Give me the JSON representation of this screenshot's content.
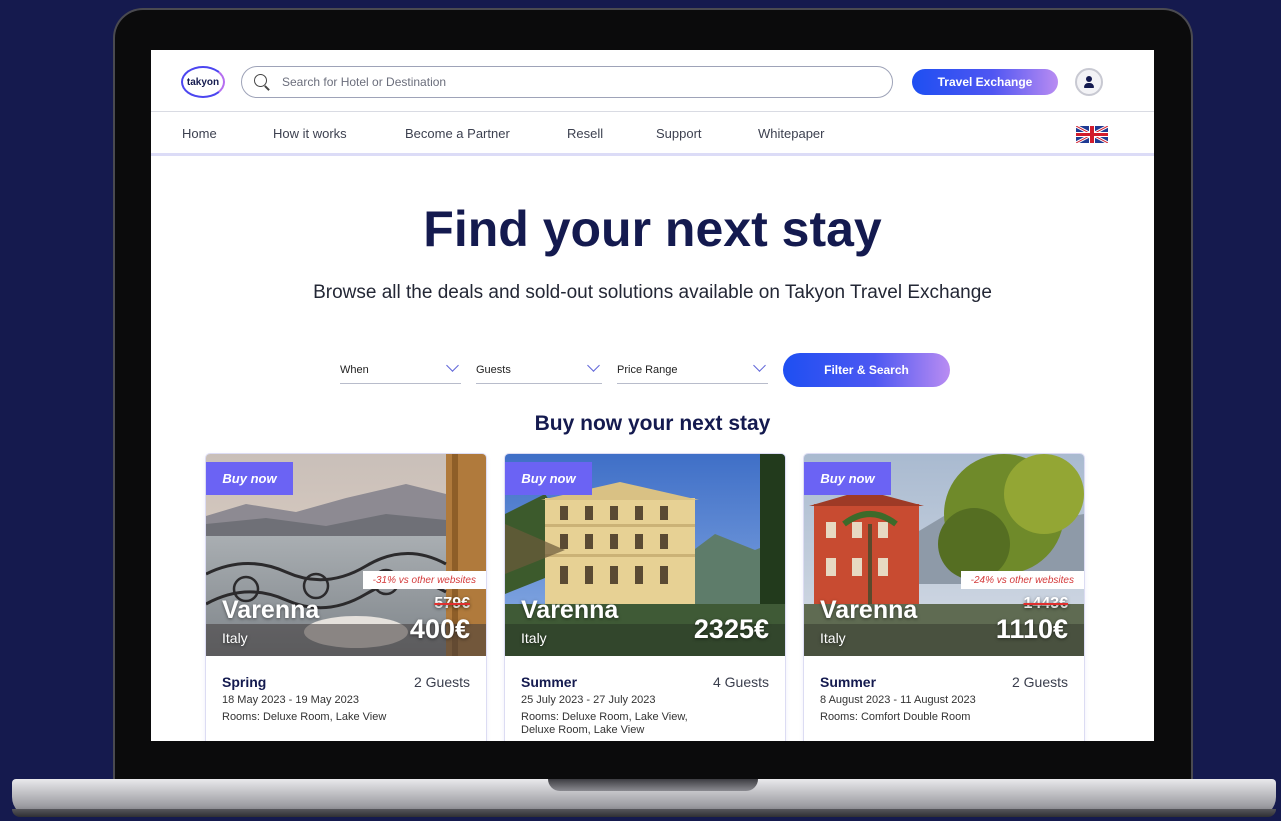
{
  "header": {
    "logo_text": "takyon",
    "search_placeholder": "Search for Hotel or Destination",
    "exchange_button": "Travel Exchange"
  },
  "nav": {
    "items": [
      "Home",
      "How it works",
      "Become a Partner",
      "Resell",
      "Support",
      "Whitepaper"
    ],
    "language_flag": "uk-flag-icon"
  },
  "hero": {
    "title": "Find your next stay",
    "subtitle": "Browse all the deals and sold-out solutions available on Takyon Travel Exchange"
  },
  "filters": {
    "when": "When",
    "guests": "Guests",
    "price_range": "Price Range",
    "button": "Filter & Search"
  },
  "section_title": "Buy now your next stay",
  "cards": [
    {
      "badge": "Buy now",
      "discount": "-31% vs other websites",
      "city": "Varenna",
      "country": "Italy",
      "old_price": "579€",
      "price": "400€",
      "season": "Spring",
      "guests": "2 Guests",
      "dates": "18 May 2023 - 19 May 2023",
      "rooms": "Rooms: Deluxe Room, Lake View"
    },
    {
      "badge": "Buy now",
      "discount": "",
      "city": "Varenna",
      "country": "Italy",
      "old_price": "",
      "price": "2325€",
      "season": "Summer",
      "guests": "4 Guests",
      "dates": "25 July 2023 - 27 July 2023",
      "rooms": "Rooms: Deluxe Room, Lake View, Deluxe Room, Lake View"
    },
    {
      "badge": "Buy now",
      "discount": "-24% vs other websites",
      "city": "Varenna",
      "country": "Italy",
      "old_price": "1443€",
      "price": "1110€",
      "season": "Summer",
      "guests": "2 Guests",
      "dates": "8 August 2023 - 11 August 2023",
      "rooms": "Rooms: Comfort Double Room"
    }
  ],
  "colors": {
    "background": "#151a4e",
    "brand_navy": "#141a4f",
    "accent_blue": "#1e4ff2",
    "accent_purple": "#6b63f4",
    "discount_red": "#d43a3a"
  }
}
